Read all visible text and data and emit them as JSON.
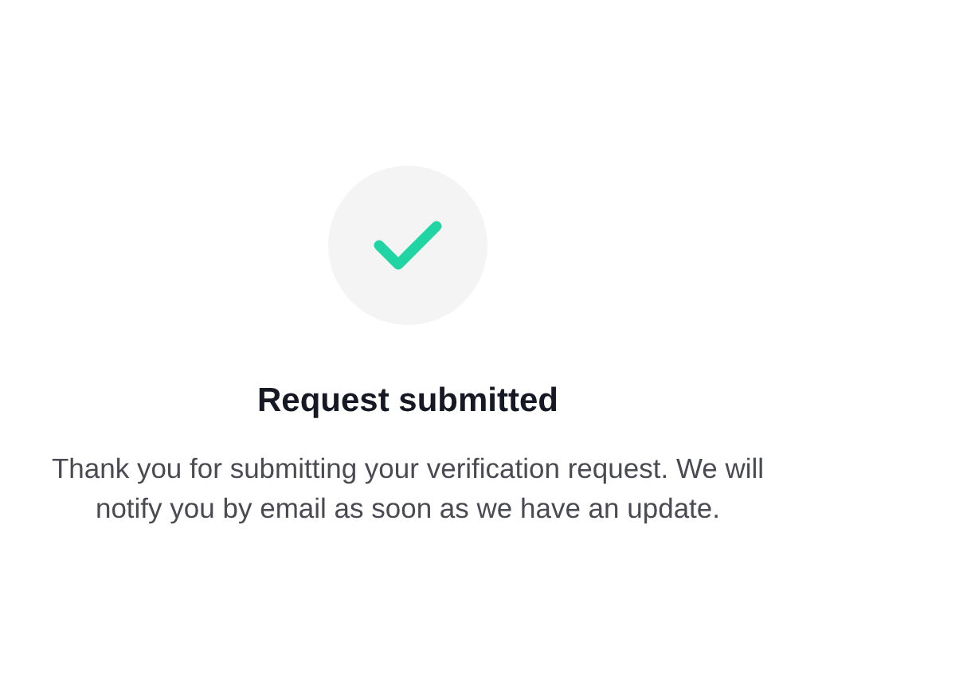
{
  "status": {
    "kind": "success"
  },
  "title": "Request submitted",
  "message": "Thank you for submitting your verification request. We will notify you by email as soon as we have an update."
}
